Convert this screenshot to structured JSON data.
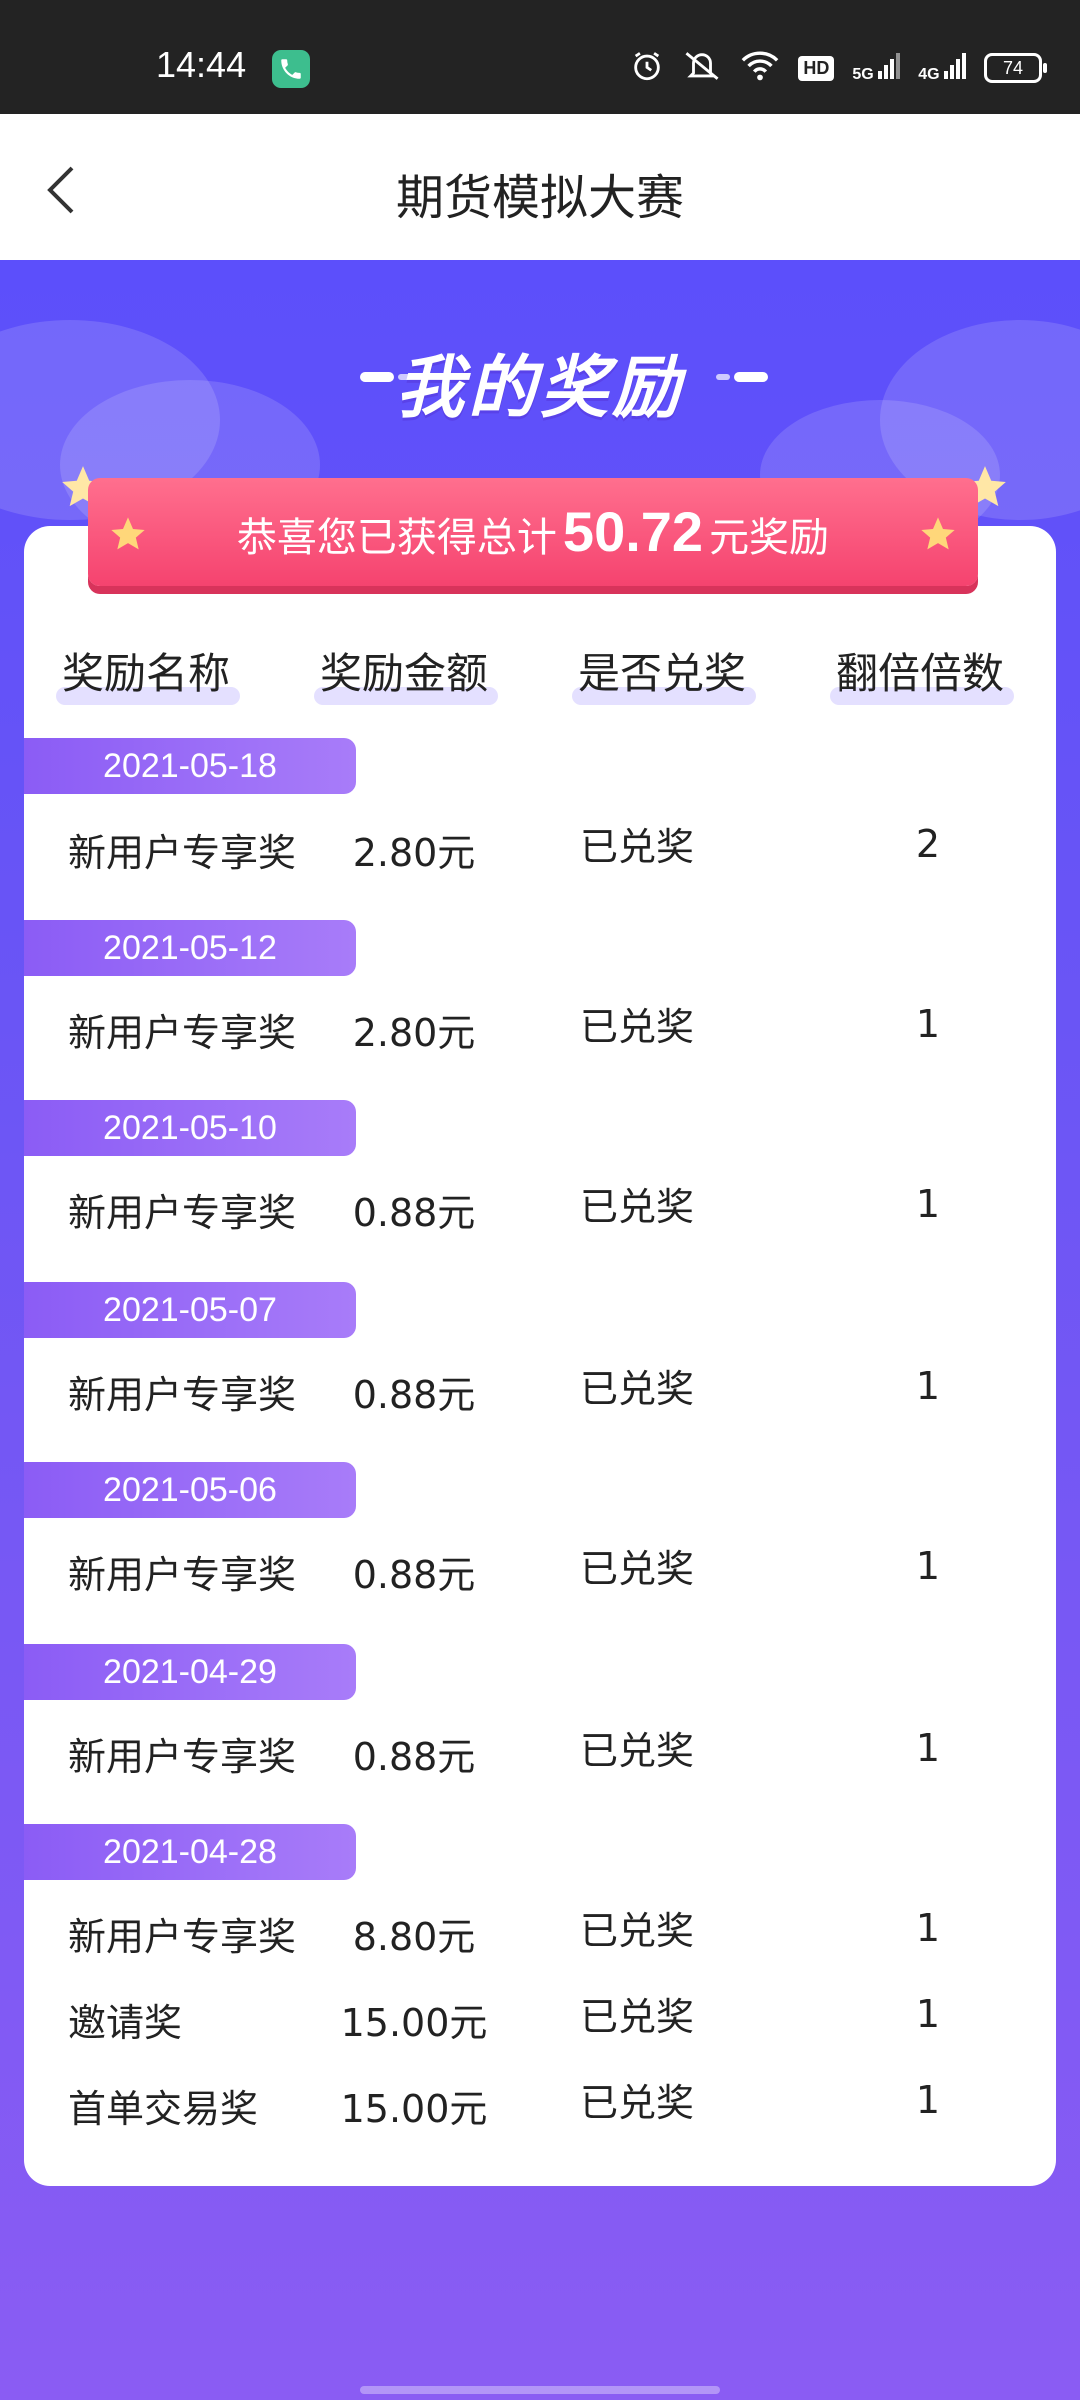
{
  "status_bar": {
    "time": "14:44",
    "icons": [
      "phone-call-icon",
      "alarm-icon",
      "mute-icon",
      "wifi-icon",
      "hd-icon",
      "5g-signal-icon",
      "4g-signal-icon",
      "battery-icon"
    ],
    "hd": "HD",
    "net1": "5G",
    "net2": "4G",
    "battery": "74"
  },
  "header": {
    "title": "期货模拟大赛"
  },
  "hero": {
    "heading": "我的奖励"
  },
  "summary": {
    "prefix": "恭喜您已获得总计",
    "amount": "50.72",
    "suffix": "元奖励"
  },
  "columns": [
    "奖励名称",
    "奖励金额",
    "是否兑奖",
    "翻倍倍数"
  ],
  "groups": [
    {
      "date": "2021-05-18",
      "rows": [
        {
          "name": "新用户专享奖",
          "amount": "2.80元",
          "status": "已兑奖",
          "multiplier": "2"
        }
      ]
    },
    {
      "date": "2021-05-12",
      "rows": [
        {
          "name": "新用户专享奖",
          "amount": "2.80元",
          "status": "已兑奖",
          "multiplier": "1"
        }
      ]
    },
    {
      "date": "2021-05-10",
      "rows": [
        {
          "name": "新用户专享奖",
          "amount": "0.88元",
          "status": "已兑奖",
          "multiplier": "1"
        }
      ]
    },
    {
      "date": "2021-05-07",
      "rows": [
        {
          "name": "新用户专享奖",
          "amount": "0.88元",
          "status": "已兑奖",
          "multiplier": "1"
        }
      ]
    },
    {
      "date": "2021-05-06",
      "rows": [
        {
          "name": "新用户专享奖",
          "amount": "0.88元",
          "status": "已兑奖",
          "multiplier": "1"
        }
      ]
    },
    {
      "date": "2021-04-29",
      "rows": [
        {
          "name": "新用户专享奖",
          "amount": "0.88元",
          "status": "已兑奖",
          "multiplier": "1"
        }
      ]
    },
    {
      "date": "2021-04-28",
      "rows": [
        {
          "name": "新用户专享奖",
          "amount": "8.80元",
          "status": "已兑奖",
          "multiplier": "1"
        },
        {
          "name": "邀请奖",
          "amount": "15.00元",
          "status": "已兑奖",
          "multiplier": "1"
        },
        {
          "name": "首单交易奖",
          "amount": "15.00元",
          "status": "已兑奖",
          "multiplier": "1"
        }
      ]
    }
  ],
  "colors": {
    "primary": "#5c4ffb",
    "ribbon": "#f5436f",
    "date_tag": "#8b5cf5",
    "column_underline": "#e4e0ff"
  }
}
